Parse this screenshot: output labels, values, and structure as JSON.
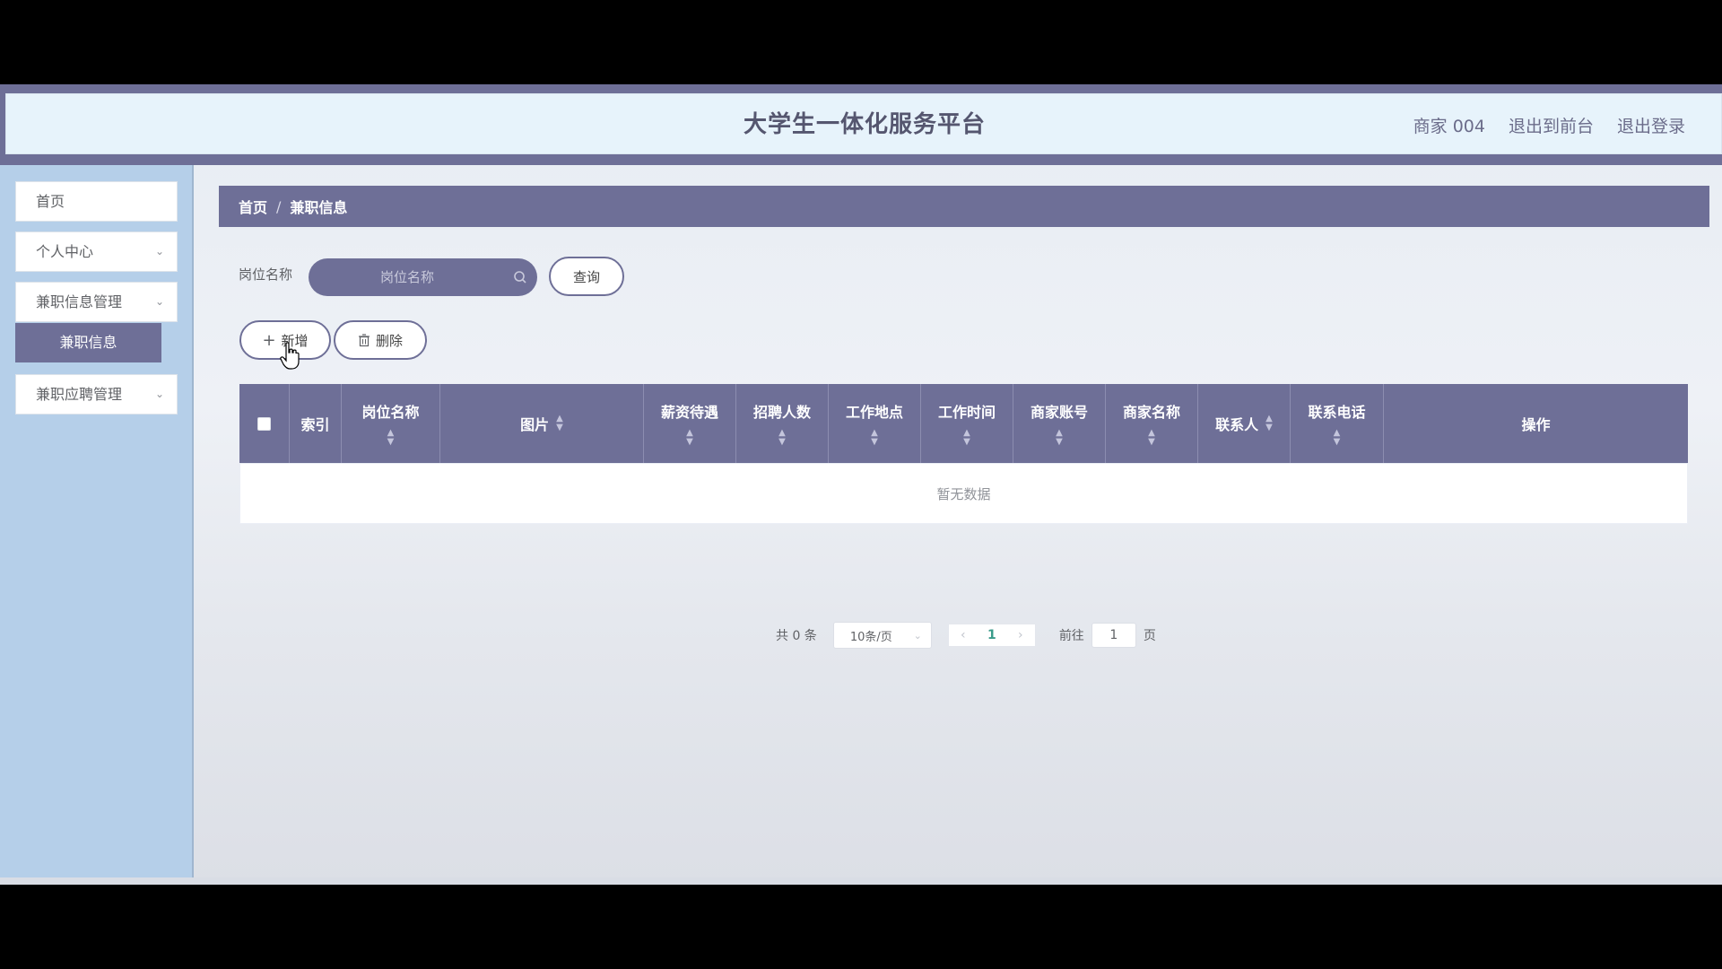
{
  "header": {
    "title": "大学生一体化服务平台",
    "user": "商家 004",
    "back_to_front": "退出到前台",
    "logout": "退出登录"
  },
  "sidebar": {
    "items": [
      {
        "label": "首页"
      },
      {
        "label": "个人中心"
      },
      {
        "label": "兼职信息管理"
      },
      {
        "label": "兼职信息"
      },
      {
        "label": "兼职应聘管理"
      }
    ]
  },
  "breadcrumb": {
    "home": "首页",
    "sep": "/",
    "current": "兼职信息"
  },
  "search": {
    "label": "岗位名称",
    "placeholder": "岗位名称",
    "value": "",
    "query_button": "查询"
  },
  "actions": {
    "add": "新增",
    "delete": "删除"
  },
  "table": {
    "columns": [
      "索引",
      "岗位名称",
      "图片",
      "薪资待遇",
      "招聘人数",
      "工作地点",
      "工作时间",
      "商家账号",
      "商家名称",
      "联系人",
      "联系电话",
      "操作"
    ],
    "rows": [],
    "empty_text": "暂无数据"
  },
  "pagination": {
    "total": "共 0 条",
    "page_size": "10条/页",
    "current_page": "1",
    "goto_label": "前往",
    "goto_value": "1",
    "page_unit": "页"
  },
  "colors": {
    "accent": "#6e6f97",
    "header_bg": "#e7f3fb",
    "sidebar_bg": "#b5cfe9"
  }
}
